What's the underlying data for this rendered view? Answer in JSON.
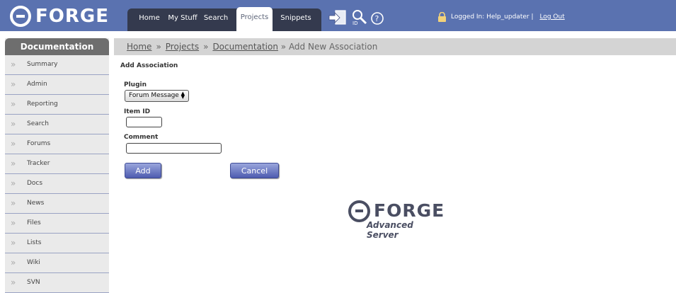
{
  "header": {
    "logo_text": "FORGE",
    "nav": [
      "Home",
      "My Stuff",
      "Search",
      "Projects",
      "Snippets"
    ],
    "active_nav": "Projects",
    "user_label": "Logged In: Help_updater |",
    "logout": "Log Out",
    "icons": [
      "signin-icon",
      "search-id-icon",
      "help-icon",
      "lock-icon"
    ]
  },
  "sidebar": {
    "title": "Documentation",
    "items": [
      "Summary",
      "Admin",
      "Reporting",
      "Search",
      "Forums",
      "Tracker",
      "Docs",
      "News",
      "Files",
      "Lists",
      "Wiki",
      "SVN"
    ]
  },
  "breadcrumb": {
    "items": [
      "Home",
      "Projects",
      "Documentation"
    ],
    "separator": "»",
    "current": "» Add New Association"
  },
  "form": {
    "title": "Add Association",
    "plugin_label": "Plugin",
    "plugin_value": "Forum Message",
    "item_id_label": "Item ID",
    "item_id_value": "",
    "comment_label": "Comment",
    "comment_value": "",
    "add_button": "Add",
    "cancel_button": "Cancel"
  },
  "footer_logo": {
    "word": "FORGE",
    "sub": "Advanced Server"
  },
  "colors": {
    "header": "#5a72b0",
    "nav": "#343a4e",
    "sidebar_title": "#6e6e6e",
    "button": "#4e5cb0"
  }
}
